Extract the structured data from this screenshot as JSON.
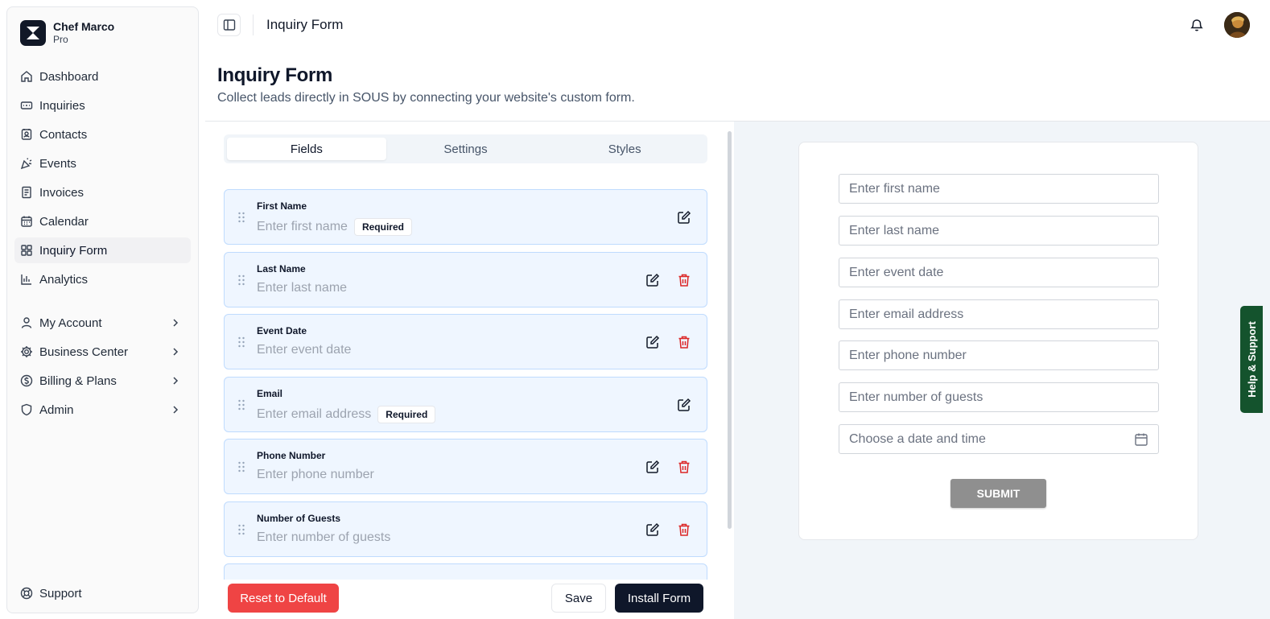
{
  "brand": {
    "name": "Chef Marco",
    "plan": "Pro"
  },
  "nav_main": [
    {
      "label": "Dashboard",
      "icon": "home-icon"
    },
    {
      "label": "Inquiries",
      "icon": "inbox-icon"
    },
    {
      "label": "Contacts",
      "icon": "contact-book-icon"
    },
    {
      "label": "Events",
      "icon": "party-popper-icon"
    },
    {
      "label": "Invoices",
      "icon": "receipt-icon"
    },
    {
      "label": "Calendar",
      "icon": "calendar-icon"
    },
    {
      "label": "Inquiry Form",
      "icon": "form-blocks-icon",
      "active": true
    },
    {
      "label": "Analytics",
      "icon": "bar-chart-icon"
    }
  ],
  "nav_account": [
    {
      "label": "My Account",
      "icon": "user-icon"
    },
    {
      "label": "Business Center",
      "icon": "settings-cog-icon"
    },
    {
      "label": "Billing & Plans",
      "icon": "dollar-circle-icon"
    },
    {
      "label": "Admin",
      "icon": "shield-icon"
    }
  ],
  "support_label": "Support",
  "topbar": {
    "title": "Inquiry Form"
  },
  "page": {
    "title": "Inquiry Form",
    "subtitle": "Collect leads directly in SOUS by connecting your website's custom form."
  },
  "tabs": [
    {
      "label": "Fields",
      "active": true
    },
    {
      "label": "Settings",
      "active": false
    },
    {
      "label": "Styles",
      "active": false
    }
  ],
  "fields": [
    {
      "label": "First Name",
      "placeholder": "Enter first name",
      "badge": "Required",
      "deletable": false
    },
    {
      "label": "Last Name",
      "placeholder": "Enter last name",
      "badge": "",
      "deletable": true
    },
    {
      "label": "Event Date",
      "placeholder": "Enter event date",
      "badge": "",
      "deletable": true
    },
    {
      "label": "Email",
      "placeholder": "Enter email address",
      "badge": "Required",
      "deletable": false
    },
    {
      "label": "Phone Number",
      "placeholder": "Enter phone number",
      "badge": "",
      "deletable": true
    },
    {
      "label": "Number of Guests",
      "placeholder": "Enter number of guests",
      "badge": "",
      "deletable": true
    },
    {
      "label": "",
      "placeholder": "",
      "badge": "",
      "deletable": true
    }
  ],
  "actions": {
    "reset": "Reset to Default",
    "save": "Save",
    "install": "Install Form"
  },
  "preview": {
    "inputs": [
      "Enter first name",
      "Enter last name",
      "Enter event date",
      "Enter email address",
      "Enter phone number",
      "Enter number of guests",
      "Choose a date and time"
    ],
    "submit": "SUBMIT"
  },
  "help_tab": "Help & Support",
  "colors": {
    "accent": "#0f172a",
    "danger": "#ef4444",
    "field_bg": "#eff6ff",
    "help_tab": "#14532d"
  }
}
